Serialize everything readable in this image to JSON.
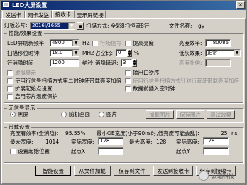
{
  "window": {
    "title": "LED大屏设置",
    "close_glyph": "×"
  },
  "tabs": [
    {
      "label": "发送卡"
    },
    {
      "label": "网卡发送"
    },
    {
      "label": "接收卡"
    },
    {
      "label": "显示屏链接"
    }
  ],
  "top": {
    "light_board_label": "灯板芯片:",
    "light_board_value": "2016Ⅰ/1655",
    "scan_text": "扫描方式: 全彩8扫恒流8行",
    "file_name_label": "文件名称:",
    "file_name_value": "gy"
  },
  "perf": {
    "legend": "性能/效果设置",
    "led_refresh_label": "LED屏刷新频率:",
    "led_refresh_value": "4800",
    "hz_unit": "HZ",
    "vsync_label": "行场信号",
    "boost_bright_label": "提高亮度",
    "brightness_eff_label": "亮度效率:",
    "brightness_eff_value": "80086",
    "scan_clock_label": "扫描移位时钟:",
    "scan_clock_value": "18.0",
    "mhz_unit": "MHZ",
    "duty_label": "占空比:",
    "duty_value": "0",
    "percent_unit": "%",
    "gray_mode_label": "低灰效果:",
    "gray_mode_value": "正常",
    "row_hidden_label": "行消隐时间",
    "row_hidden_value": "1200",
    "ns_unit": "纳秒",
    "blank_delay_label": "消隐延迟:",
    "blank_delay_value": "3",
    "brightness_comp_label": "亮度补偿:",
    "options": [
      {
        "label": "虚拟显示",
        "disabled": true
      },
      {
        "label": "输出口逆序",
        "disabled": false
      },
      {
        "label": "使用行信号扫描方式第二时钟使带载亮度加倍",
        "disabled": false
      },
      {
        "label": "使用行信号扫描方式针对行管使带载亮度加倍",
        "disabled": true
      },
      {
        "label": "扩展起始点设置",
        "disabled": false
      },
      {
        "label": "数据前插入空时钟",
        "disabled": false
      },
      {
        "label": "启用芯片温度保护",
        "disabled": false
      }
    ]
  },
  "nosignal": {
    "legend": "无信号显示",
    "options": [
      {
        "label": "黑屏",
        "selected": true
      },
      {
        "label": "随机画面",
        "selected": false
      },
      {
        "label": "图片",
        "selected": false
      }
    ],
    "buttons": [
      "加载图片",
      "保存图片",
      "测试效果"
    ]
  },
  "load": {
    "legend": "带载设置",
    "efficiency_label": "亮度有效率(全消隐):",
    "efficiency_value": "95.55%",
    "min_oe_text": "最小OE宽度(小于90ns时,低亮度可能会乱):",
    "min_oe_value": "25",
    "ns_unit": "ns",
    "max_width_label": "最大宽度:",
    "max_width_value": "1014",
    "actual_width_label": "实际宽度:",
    "actual_width_value": "128",
    "max_height_label": "最大高度:",
    "max_height_value": "128",
    "actual_height_label": "实际高度:",
    "actual_height_value": "128",
    "set_start_label": "设置起始位置",
    "start_x_label": "起点X",
    "start_y_label": "起点Y"
  },
  "footer": {
    "buttons": [
      "智能设置",
      "从文件加载",
      "保存到文件",
      "发送到接收卡",
      "保存到接收卡"
    ]
  },
  "watermark": "云端科技"
}
